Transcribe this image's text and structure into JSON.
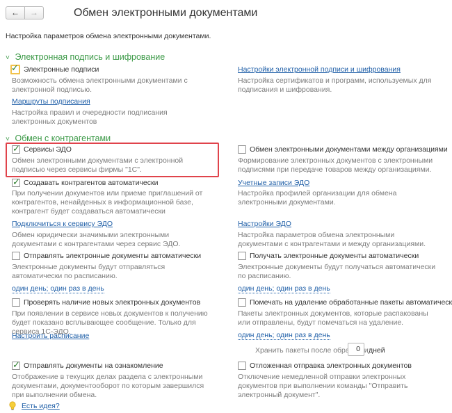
{
  "window": {
    "title": "Обмен электронными документами",
    "subtitle": "Настройка параметров обмена электронными документами.",
    "back_glyph": "←",
    "forward_glyph": "→"
  },
  "sections": {
    "signature": "Электронная подпись и шифрование",
    "counterparties": "Обмен с контрагентами"
  },
  "signature": {
    "esign": {
      "label": "Электронные подписи",
      "checked": true,
      "desc": "Возможность обмена электронными документами с электронной подписью."
    },
    "esign_settings": {
      "label": "Настройки электронной подписи и шифрования",
      "desc": "Настройка сертификатов и программ, используемых для подписания и шифрования."
    },
    "routes": {
      "label": "Маршруты подписания",
      "desc": "Настройка правил и очередности подписания электронных документов"
    }
  },
  "exchange": {
    "edo_services": {
      "label": "Сервисы ЭДО",
      "checked": true,
      "desc": "Обмен электронными документами с электронной подписью через сервисы фирмы \"1С\"."
    },
    "between_orgs": {
      "label": "Обмен электронными документами между организациями",
      "checked": false,
      "desc": "Формирование электронных документов с электронными подписями при передаче товаров между организациями."
    },
    "auto_counterparty": {
      "label": "Создавать контрагентов автоматически",
      "checked": true,
      "desc": "При получении документов или приеме приглашений от контрагентов, ненайденных в информационной базе, контрагент будет создаваться автоматически"
    },
    "accounts": {
      "label": "Учетные записи ЭДО",
      "desc": "Настройка профилей организации для обмена электронными документами."
    },
    "connect": {
      "label": "Подключиться к сервису ЭДО",
      "desc": "Обмен юридически значимыми электронными документами с контрагентами через сервис ЭДО."
    },
    "edo_settings": {
      "label": "Настройки ЭДО",
      "desc": "Настройка параметров обмена электронными документами с контрагентами и между организациями."
    },
    "send_auto": {
      "label": "Отправлять электронные документы автоматически",
      "checked": false,
      "desc": "Электронные документы будут отправляться автоматически по расписанию.",
      "schedule": "один день; один раз в день"
    },
    "receive_auto": {
      "label": "Получать электронные документы автоматически",
      "checked": false,
      "desc": "Электронные документы будут получаться автоматически по расписанию.",
      "schedule": "один день; один раз в день"
    },
    "check_new": {
      "label": "Проверять наличие новых электронных документов",
      "checked": false,
      "desc": "При появлении в сервисе новых документов к получению будет показано всплывающее сообщение. Только для сервиса 1С-ЭДО.",
      "schedule_link": "Настроить расписание"
    },
    "mark_delete": {
      "label": "Помечать на удаление обработанные пакеты автоматически",
      "checked": false,
      "desc": "Пакеты электронных документов, которые распакованы или отправлены, будут помечаться на удаление.",
      "schedule": "один день; один раз в день",
      "keep_label": "Хранить пакеты после обработки:",
      "keep_value": "0",
      "keep_unit": "дней"
    },
    "for_review": {
      "label": "Отправлять документы на ознакомление",
      "checked": true,
      "desc": "Отображение в текущих делах  раздела с электронными документами, документооборот по которым завершился при выполнении обмена."
    },
    "deferred": {
      "label": "Отложенная отправка электронных документов",
      "checked": false,
      "desc": "Отключение немедленной отправки электронных документов при выполнении команды \"Отправить электронный документ\"."
    }
  },
  "footer": {
    "ideas_link": "Есть идея?",
    "bulb_icon": "lightbulb-icon"
  }
}
